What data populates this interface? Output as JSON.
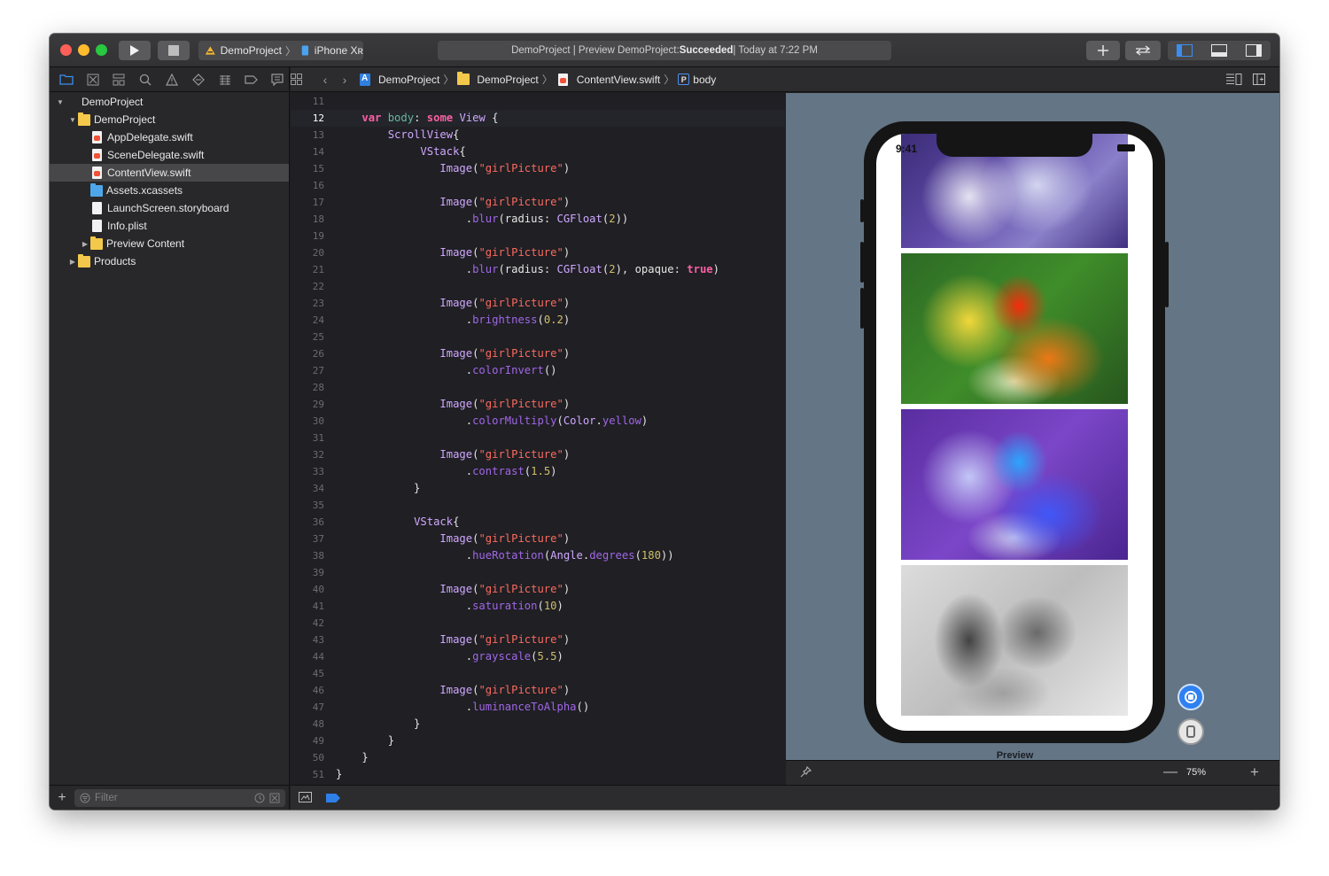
{
  "toolbar": {
    "scheme_project": "DemoProject",
    "scheme_device": "iPhone Xʀ",
    "activity": {
      "prefix": "DemoProject | Preview DemoProject: ",
      "status": "Succeeded",
      "time": " | Today at 7:22 PM"
    }
  },
  "navigator": {
    "tree": [
      {
        "label": "DemoProject",
        "type": "project",
        "indent": 0,
        "disclosure": "open"
      },
      {
        "label": "DemoProject",
        "type": "folder",
        "indent": 1,
        "disclosure": "open"
      },
      {
        "label": "AppDelegate.swift",
        "type": "swift",
        "indent": 2
      },
      {
        "label": "SceneDelegate.swift",
        "type": "swift",
        "indent": 2
      },
      {
        "label": "ContentView.swift",
        "type": "swift",
        "indent": 2,
        "selected": true
      },
      {
        "label": "Assets.xcassets",
        "type": "bluefolder",
        "indent": 2
      },
      {
        "label": "LaunchScreen.storyboard",
        "type": "doc",
        "indent": 2
      },
      {
        "label": "Info.plist",
        "type": "doc",
        "indent": 2
      },
      {
        "label": "Preview Content",
        "type": "folder",
        "indent": 2,
        "disclosure": "closed"
      },
      {
        "label": "Products",
        "type": "folder",
        "indent": 1,
        "disclosure": "closed"
      }
    ],
    "filter_placeholder": "Filter"
  },
  "jumpbar": {
    "crumbs": [
      "DemoProject",
      "DemoProject",
      "ContentView.swift",
      "body"
    ]
  },
  "editor": {
    "current_line": 12,
    "lines": [
      {
        "n": 11,
        "t": ""
      },
      {
        "n": 12,
        "t": "    var body: some View {"
      },
      {
        "n": 13,
        "t": "        ScrollView{"
      },
      {
        "n": 14,
        "t": "             VStack{"
      },
      {
        "n": 15,
        "t": "                Image(\"girlPicture\")"
      },
      {
        "n": 16,
        "t": ""
      },
      {
        "n": 17,
        "t": "                Image(\"girlPicture\")"
      },
      {
        "n": 18,
        "t": "                    .blur(radius: CGFloat(2))"
      },
      {
        "n": 19,
        "t": ""
      },
      {
        "n": 20,
        "t": "                Image(\"girlPicture\")"
      },
      {
        "n": 21,
        "t": "                    .blur(radius: CGFloat(2), opaque: true)"
      },
      {
        "n": 22,
        "t": ""
      },
      {
        "n": 23,
        "t": "                Image(\"girlPicture\")"
      },
      {
        "n": 24,
        "t": "                    .brightness(0.2)"
      },
      {
        "n": 25,
        "t": ""
      },
      {
        "n": 26,
        "t": "                Image(\"girlPicture\")"
      },
      {
        "n": 27,
        "t": "                    .colorInvert()"
      },
      {
        "n": 28,
        "t": ""
      },
      {
        "n": 29,
        "t": "                Image(\"girlPicture\")"
      },
      {
        "n": 30,
        "t": "                    .colorMultiply(Color.yellow)"
      },
      {
        "n": 31,
        "t": ""
      },
      {
        "n": 32,
        "t": "                Image(\"girlPicture\")"
      },
      {
        "n": 33,
        "t": "                    .contrast(1.5)"
      },
      {
        "n": 34,
        "t": "            }"
      },
      {
        "n": 35,
        "t": ""
      },
      {
        "n": 36,
        "t": "            VStack{"
      },
      {
        "n": 37,
        "t": "                Image(\"girlPicture\")"
      },
      {
        "n": 38,
        "t": "                    .hueRotation(Angle.degrees(180))"
      },
      {
        "n": 39,
        "t": ""
      },
      {
        "n": 40,
        "t": "                Image(\"girlPicture\")"
      },
      {
        "n": 41,
        "t": "                    .saturation(10)"
      },
      {
        "n": 42,
        "t": ""
      },
      {
        "n": 43,
        "t": "                Image(\"girlPicture\")"
      },
      {
        "n": 44,
        "t": "                    .grayscale(5.5)"
      },
      {
        "n": 45,
        "t": ""
      },
      {
        "n": 46,
        "t": "                Image(\"girlPicture\")"
      },
      {
        "n": 47,
        "t": "                    .luminanceToAlpha()"
      },
      {
        "n": 48,
        "t": "            }"
      },
      {
        "n": 49,
        "t": "        }"
      },
      {
        "n": 50,
        "t": "    }"
      },
      {
        "n": 51,
        "t": "}"
      }
    ]
  },
  "canvas": {
    "preview_label": "Preview",
    "status_time": "9:41",
    "zoom": "75%"
  },
  "colors": {
    "accent": "#3b8ef0",
    "keyword": "#fc5fa3",
    "string": "#fc6a5d",
    "number": "#d0bf69"
  }
}
